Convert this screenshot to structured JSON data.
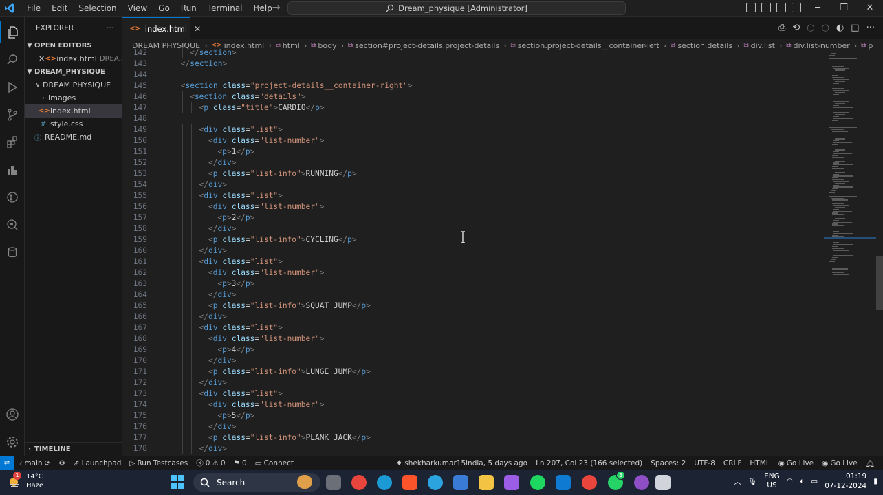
{
  "titlebar": {
    "menu": [
      "File",
      "Edit",
      "Selection",
      "View",
      "Go",
      "Run",
      "Terminal",
      "Help"
    ],
    "command_center": "Dream_physique [Administrator]"
  },
  "sidebar": {
    "title": "EXPLORER",
    "open_editors_label": "OPEN EDITORS",
    "open_editor_file": "index.html",
    "open_editor_folder": "DREA...",
    "workspace_label": "DREAM_PHYSIQUE",
    "folder": "DREAM PHYSIQUE",
    "items": [
      {
        "label": "Images",
        "type": "folder"
      },
      {
        "label": "index.html",
        "type": "html"
      },
      {
        "label": "style.css",
        "type": "css"
      },
      {
        "label": "README.md",
        "type": "md"
      }
    ],
    "timeline_label": "TIMELINE"
  },
  "editor": {
    "tab_label": "index.html",
    "breadcrumbs": [
      "DREAM PHYSIQUE",
      "index.html",
      "html",
      "body",
      "section#project-details.project-details",
      "section.project-details__container-left",
      "section.details",
      "div.list",
      "div.list-number",
      "p"
    ]
  },
  "code_lines": [
    {
      "n": "142",
      "i": 3,
      "k": "close",
      "tag": "section",
      "cls": "",
      "txt": ""
    },
    {
      "n": "143",
      "i": 2,
      "k": "close",
      "tag": "section",
      "cls": "",
      "txt": ""
    },
    {
      "n": "144",
      "i": 0,
      "k": "empty",
      "tag": "",
      "cls": "",
      "txt": ""
    },
    {
      "n": "145",
      "i": 2,
      "k": "open",
      "tag": "section",
      "cls": "project-details__container-right",
      "txt": ""
    },
    {
      "n": "146",
      "i": 3,
      "k": "open",
      "tag": "section",
      "cls": "details",
      "txt": ""
    },
    {
      "n": "147",
      "i": 4,
      "k": "inline",
      "tag": "p",
      "cls": "title",
      "txt": "CARDIO"
    },
    {
      "n": "148",
      "i": 0,
      "k": "empty",
      "tag": "",
      "cls": "",
      "txt": ""
    },
    {
      "n": "149",
      "i": 4,
      "k": "open",
      "tag": "div",
      "cls": "list",
      "txt": ""
    },
    {
      "n": "150",
      "i": 5,
      "k": "open",
      "tag": "div",
      "cls": "list-number",
      "txt": ""
    },
    {
      "n": "151",
      "i": 6,
      "k": "inline",
      "tag": "p",
      "cls": "",
      "txt": "1"
    },
    {
      "n": "152",
      "i": 5,
      "k": "close",
      "tag": "div",
      "cls": "",
      "txt": ""
    },
    {
      "n": "153",
      "i": 5,
      "k": "inline",
      "tag": "p",
      "cls": "list-info",
      "txt": "RUNNING"
    },
    {
      "n": "154",
      "i": 4,
      "k": "close",
      "tag": "div",
      "cls": "",
      "txt": ""
    },
    {
      "n": "155",
      "i": 4,
      "k": "open",
      "tag": "div",
      "cls": "list",
      "txt": ""
    },
    {
      "n": "156",
      "i": 5,
      "k": "open",
      "tag": "div",
      "cls": "list-number",
      "txt": ""
    },
    {
      "n": "157",
      "i": 6,
      "k": "inline",
      "tag": "p",
      "cls": "",
      "txt": "2"
    },
    {
      "n": "158",
      "i": 5,
      "k": "close",
      "tag": "div",
      "cls": "",
      "txt": ""
    },
    {
      "n": "159",
      "i": 5,
      "k": "inline",
      "tag": "p",
      "cls": "list-info",
      "txt": "CYCLING"
    },
    {
      "n": "160",
      "i": 4,
      "k": "close",
      "tag": "div",
      "cls": "",
      "txt": ""
    },
    {
      "n": "161",
      "i": 4,
      "k": "open",
      "tag": "div",
      "cls": "list",
      "txt": ""
    },
    {
      "n": "162",
      "i": 5,
      "k": "open",
      "tag": "div",
      "cls": "list-number",
      "txt": ""
    },
    {
      "n": "163",
      "i": 6,
      "k": "inline",
      "tag": "p",
      "cls": "",
      "txt": "3"
    },
    {
      "n": "164",
      "i": 5,
      "k": "close",
      "tag": "div",
      "cls": "",
      "txt": ""
    },
    {
      "n": "165",
      "i": 5,
      "k": "inline",
      "tag": "p",
      "cls": "list-info",
      "txt": "SQUAT JUMP"
    },
    {
      "n": "166",
      "i": 4,
      "k": "close",
      "tag": "div",
      "cls": "",
      "txt": ""
    },
    {
      "n": "167",
      "i": 4,
      "k": "open",
      "tag": "div",
      "cls": "list",
      "txt": ""
    },
    {
      "n": "168",
      "i": 5,
      "k": "open",
      "tag": "div",
      "cls": "list-number",
      "txt": ""
    },
    {
      "n": "169",
      "i": 6,
      "k": "inline",
      "tag": "p",
      "cls": "",
      "txt": "4"
    },
    {
      "n": "170",
      "i": 5,
      "k": "close",
      "tag": "div",
      "cls": "",
      "txt": ""
    },
    {
      "n": "171",
      "i": 5,
      "k": "inline",
      "tag": "p",
      "cls": "list-info",
      "txt": "LUNGE JUMP"
    },
    {
      "n": "172",
      "i": 4,
      "k": "close",
      "tag": "div",
      "cls": "",
      "txt": ""
    },
    {
      "n": "173",
      "i": 4,
      "k": "open",
      "tag": "div",
      "cls": "list",
      "txt": ""
    },
    {
      "n": "174",
      "i": 5,
      "k": "open",
      "tag": "div",
      "cls": "list-number",
      "txt": ""
    },
    {
      "n": "175",
      "i": 6,
      "k": "inline",
      "tag": "p",
      "cls": "",
      "txt": "5"
    },
    {
      "n": "176",
      "i": 5,
      "k": "close",
      "tag": "div",
      "cls": "",
      "txt": ""
    },
    {
      "n": "177",
      "i": 5,
      "k": "inline",
      "tag": "p",
      "cls": "list-info",
      "txt": "PLANK JACK"
    },
    {
      "n": "178",
      "i": 4,
      "k": "close",
      "tag": "div",
      "cls": "",
      "txt": ""
    }
  ],
  "statusbar": {
    "branch": "main",
    "launchpad": "Launchpad",
    "run_testcases": "Run Testcases",
    "errors": "0",
    "warnings": "0",
    "ports": "0",
    "connect": "Connect",
    "blame": "shekharkumar15india, 5 days ago",
    "position": "Ln 207, Col 23 (166 selected)",
    "spaces": "Spaces: 2",
    "encoding": "UTF-8",
    "eol": "CRLF",
    "language": "HTML",
    "go_live_1": "Go Live",
    "go_live_2": "Go Live"
  },
  "taskbar": {
    "temperature": "14°C",
    "weather": "Haze",
    "weather_badge": "1",
    "search_placeholder": "Search",
    "whatsapp_badge": "3",
    "lang": "ENG",
    "region": "US",
    "time": "01:19",
    "date": "07-12-2024"
  },
  "colors": {
    "accent": "#0078d4",
    "tag": "#569cd6",
    "attr": "#9cdcfe",
    "string": "#ce9178"
  }
}
